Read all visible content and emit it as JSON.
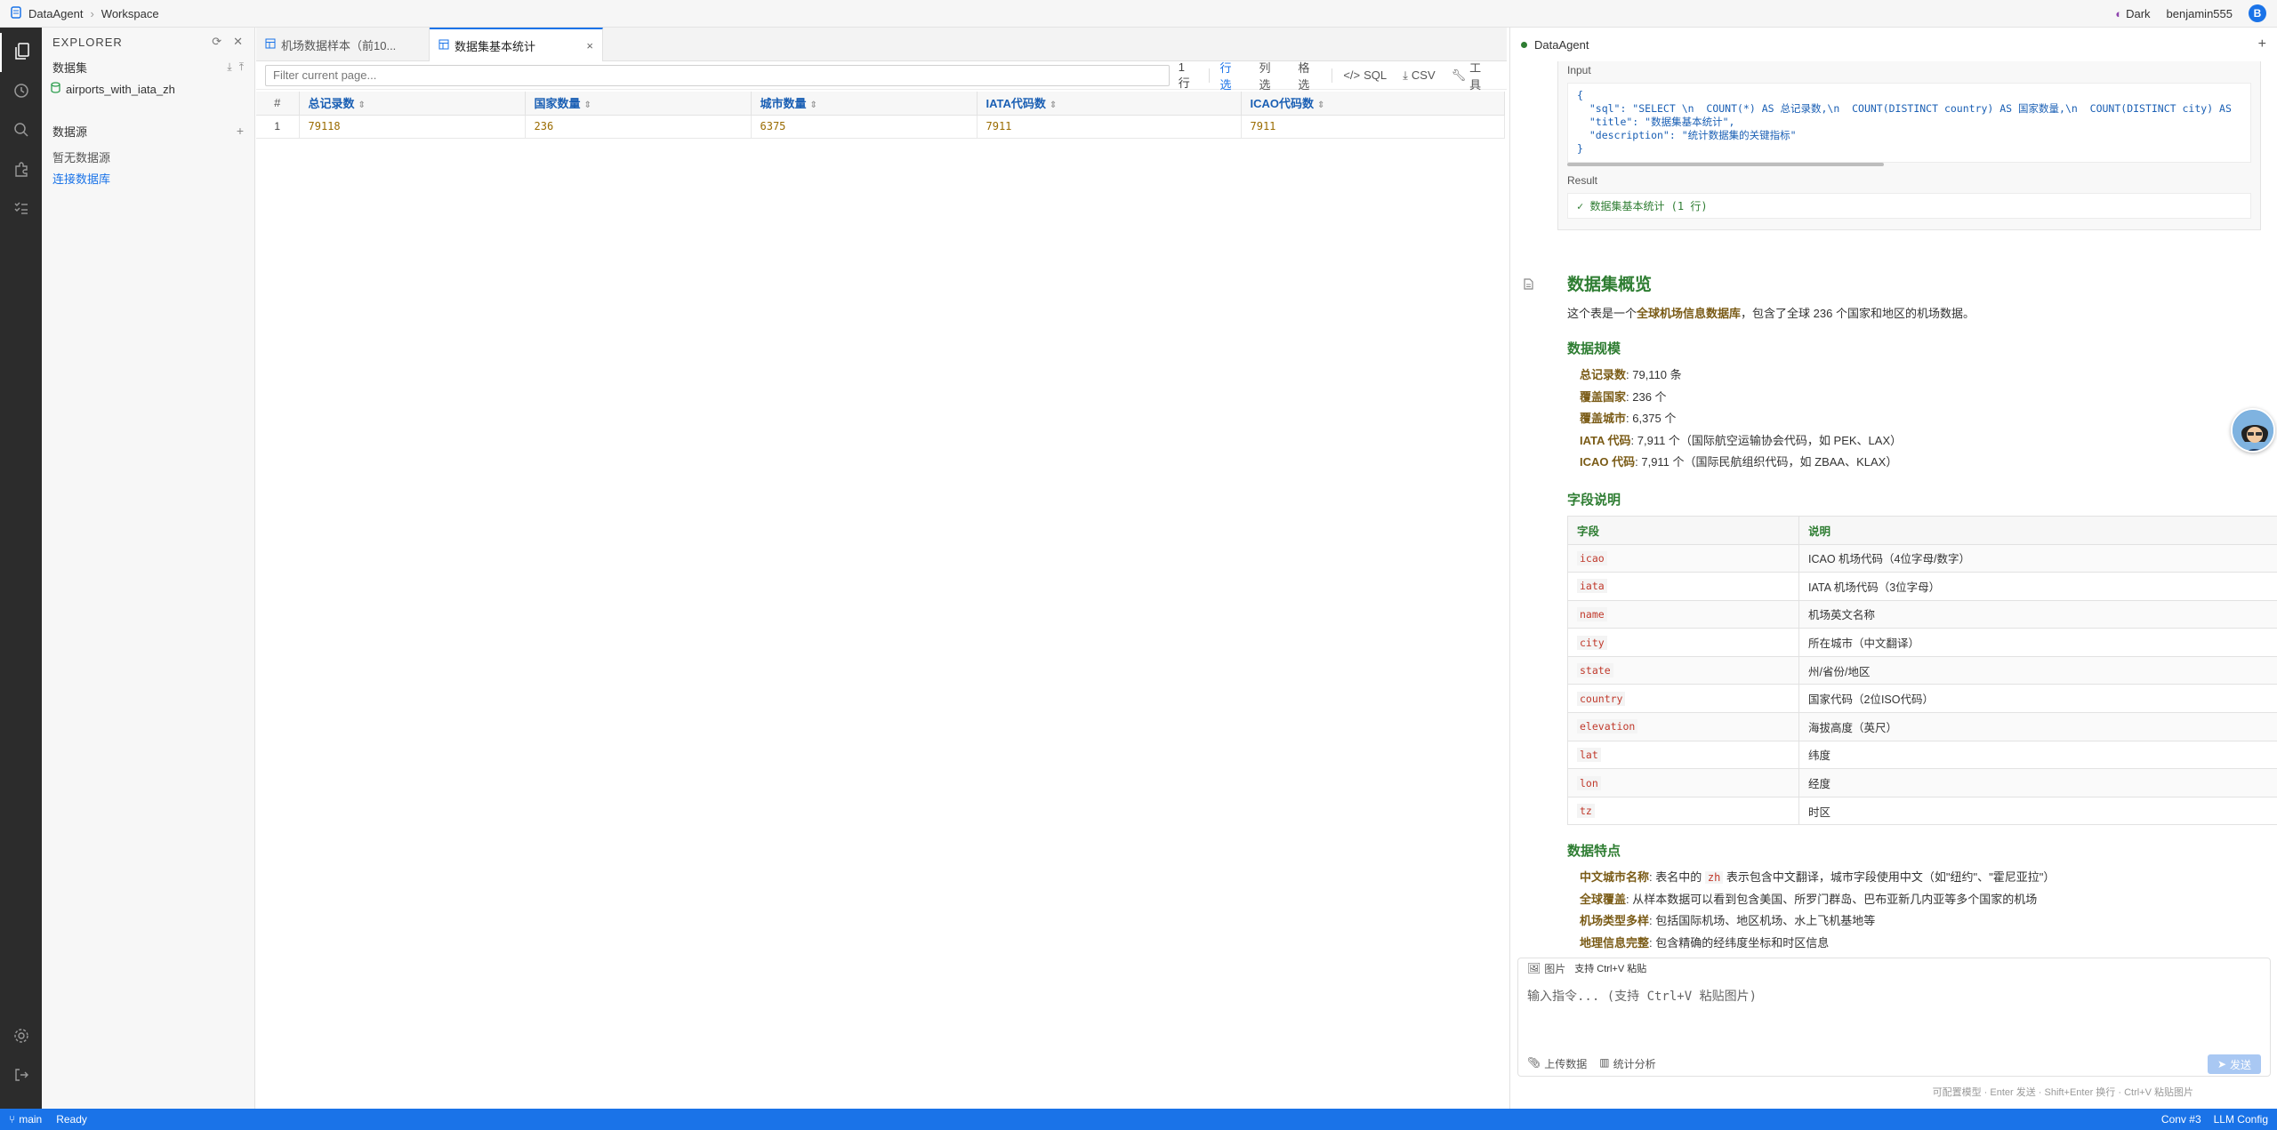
{
  "titlebar": {
    "app": "DataAgent",
    "crumb": "Workspace",
    "theme": "Dark",
    "user": "benjamin555",
    "avatar_letter": "B"
  },
  "explorer": {
    "title": "EXPLORER",
    "datasets_label": "数据集",
    "dataset_item": "airports_with_iata_zh",
    "sources_label": "数据源",
    "no_source": "暂无数据源",
    "connect_db": "连接数据库"
  },
  "editor": {
    "tabs": [
      {
        "label": "机场数据样本（前10..."
      },
      {
        "label": "数据集基本统计",
        "close": "×"
      }
    ],
    "filter_placeholder": "Filter current page...",
    "row_count": "1 行",
    "buttons": {
      "row_filter": "行选",
      "col_filter": "列选",
      "cell_filter": "格选",
      "sql": "SQL",
      "csv": "CSV",
      "tools": "工具"
    },
    "table": {
      "rownum_header": "#",
      "columns": [
        "总记录数",
        "国家数量",
        "城市数量",
        "IATA代码数",
        "ICAO代码数"
      ],
      "rows": [
        {
          "n": "1",
          "cells": [
            "79118",
            "236",
            "6375",
            "7911",
            "7911"
          ]
        }
      ]
    }
  },
  "agent": {
    "title": "DataAgent",
    "input_label": "Input",
    "code": "{\n  \"sql\": \"SELECT \\n  COUNT(*) AS 总记录数,\\n  COUNT(DISTINCT country) AS 国家数量,\\n  COUNT(DISTINCT city) AS \n  \"title\": \"数据集基本统计\",\n  \"description\": \"统计数据集的关键指标\"\n}",
    "result_label": "Result",
    "result_text": "✓ 数据集基本统计 (1 行)",
    "md": {
      "h1": "数据集概览",
      "intro_pre": "这个表是一个",
      "intro_bold": "全球机场信息数据库",
      "intro_post": "，包含了全球 236 个国家和地区的机场数据。",
      "h2_scale": "数据规模",
      "scale": [
        {
          "k": "总记录数",
          "v": ": 79,110 条"
        },
        {
          "k": "覆盖国家",
          "v": ": 236 个"
        },
        {
          "k": "覆盖城市",
          "v": ": 6,375 个"
        },
        {
          "k": "IATA 代码",
          "v": ": 7,911 个（国际航空运输协会代码，如 PEK、LAX）"
        },
        {
          "k": "ICAO 代码",
          "v": ": 7,911 个（国际民航组织代码，如 ZBAA、KLAX）"
        }
      ],
      "h2_fields": "字段说明",
      "fields_head": [
        "字段",
        "说明"
      ],
      "fields": [
        {
          "f": "icao",
          "d": "ICAO 机场代码（4位字母/数字）"
        },
        {
          "f": "iata",
          "d": "IATA 机场代码（3位字母）"
        },
        {
          "f": "name",
          "d": "机场英文名称"
        },
        {
          "f": "city",
          "d": "所在城市（中文翻译）"
        },
        {
          "f": "state",
          "d": "州/省份/地区"
        },
        {
          "f": "country",
          "d": "国家代码（2位ISO代码）"
        },
        {
          "f": "elevation",
          "d": "海拔高度（英尺）"
        },
        {
          "f": "lat",
          "d": "纬度"
        },
        {
          "f": "lon",
          "d": "经度"
        },
        {
          "f": "tz",
          "d": "时区"
        }
      ],
      "h2_features": "数据特点",
      "feat1_k": "中文城市名称",
      "feat1_pre": ": 表名中的 ",
      "feat1_code": "zh",
      "feat1_post": " 表示包含中文翻译，城市字段使用中文（如\"纽约\"、\"霍尼亚拉\"）",
      "feat2_k": "全球覆盖",
      "feat2_v": ": 从样本数据可以看到包含美国、所罗门群岛、巴布亚新几内亚等多个国家的机场",
      "feat3_k": "机场类型多样",
      "feat3_v": ": 包括国际机场、地区机场、水上飞机基地等",
      "feat4_k": "地理信息完整",
      "feat4_v": ": 包含精确的经纬度坐标和时区信息"
    },
    "composer": {
      "image_label": "图片",
      "paste_hint": "支持 Ctrl+V 粘贴",
      "placeholder": "输入指令... (支持 Ctrl+V 粘贴图片)",
      "upload": "上传数据",
      "stats": "统计分析",
      "send": "发送",
      "footer_hint": "可配置模型 · Enter 发送 · Shift+Enter 换行 · Ctrl+V 粘贴图片"
    }
  },
  "statusbar": {
    "branch": "main",
    "status": "Ready",
    "conv": "Conv #3",
    "llm": "LLM Config"
  }
}
